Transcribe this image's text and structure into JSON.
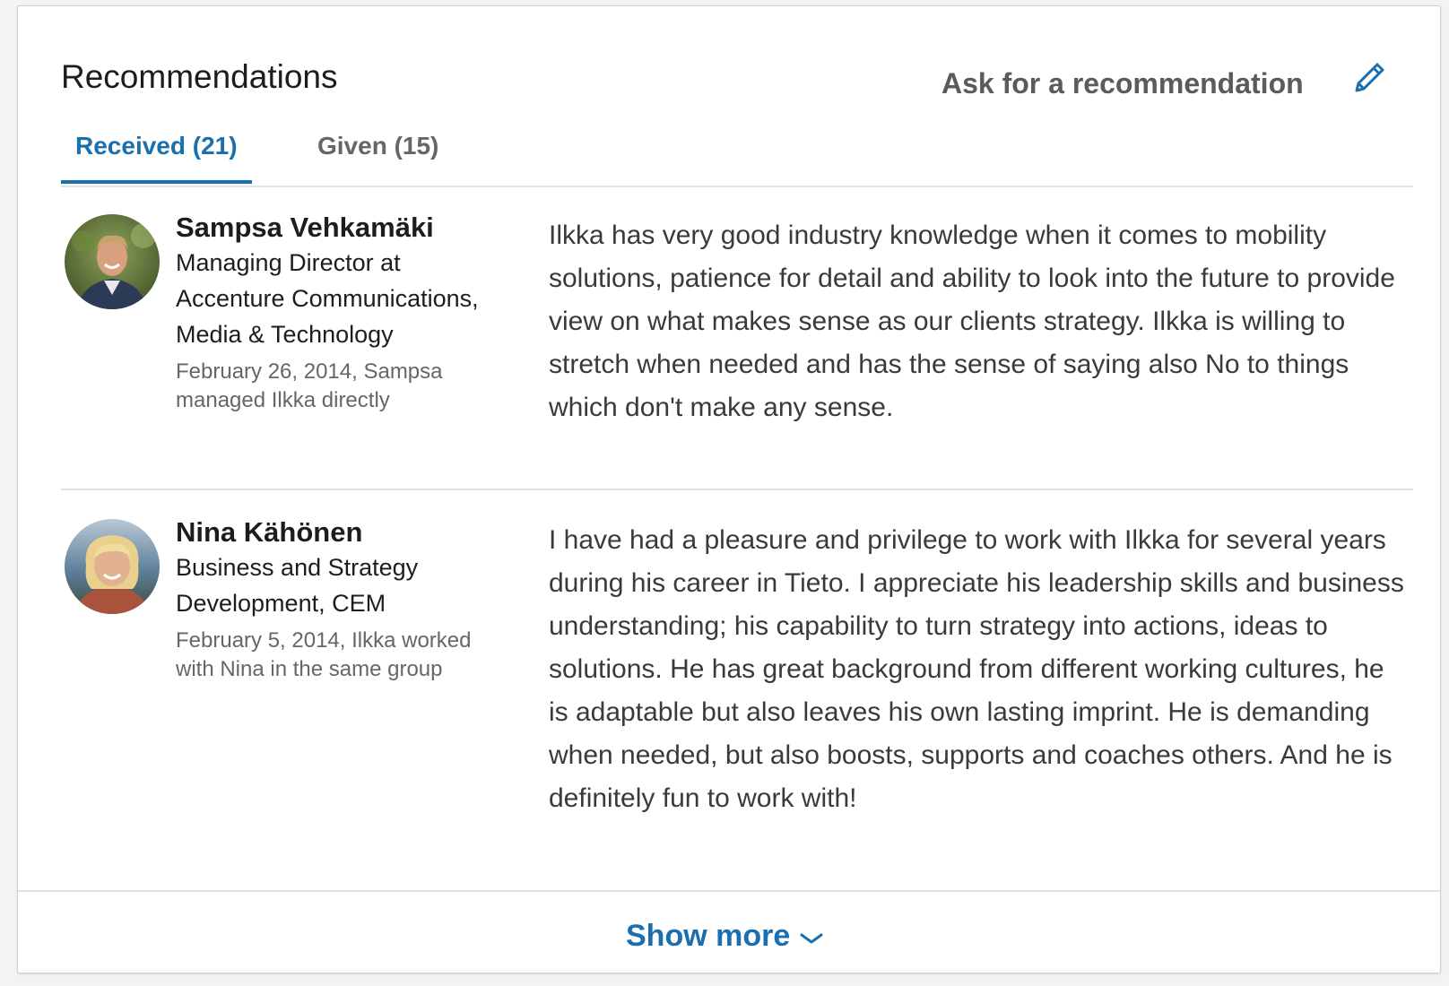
{
  "section": {
    "title": "Recommendations",
    "ask_label": "Ask for a recommendation",
    "edit_icon": "pencil-icon"
  },
  "tabs": [
    {
      "label": "Received (21)",
      "active": true
    },
    {
      "label": "Given (15)",
      "active": false
    }
  ],
  "recommendations": [
    {
      "name": "Sampsa Vehkamäki",
      "headline": "Managing Director at Accenture Communications, Media & Technology",
      "date": "February 26, 2014, Sampsa managed Ilkka directly",
      "text": "Ilkka has very good industry knowledge when it comes to mobility solutions, patience for detail and ability to look into the future to provide view on what makes sense as our clients strategy. Ilkka is willing to stretch when needed and has the sense of saying also No to things which don't make any sense."
    },
    {
      "name": "Nina Kähönen",
      "headline": "Business and Strategy Development, CEM",
      "date": "February 5, 2014, Ilkka worked with Nina in the same group",
      "text": "I have had a pleasure and privilege to work with Ilkka for several years during his career in Tieto. I appreciate his leadership skills and business understanding; his capability to turn strategy into actions, ideas to solutions. He has great background from different working cultures, he is adaptable but also leaves his own lasting imprint. He is demanding when needed, but also boosts, supports and coaches others. And he is definitely fun to work with!"
    }
  ],
  "footer": {
    "show_more_label": "Show more",
    "chevron_icon": "chevron-down-icon"
  },
  "colors": {
    "accent": "#1a6faf",
    "muted": "#666666",
    "divider": "#e1e1e1"
  }
}
